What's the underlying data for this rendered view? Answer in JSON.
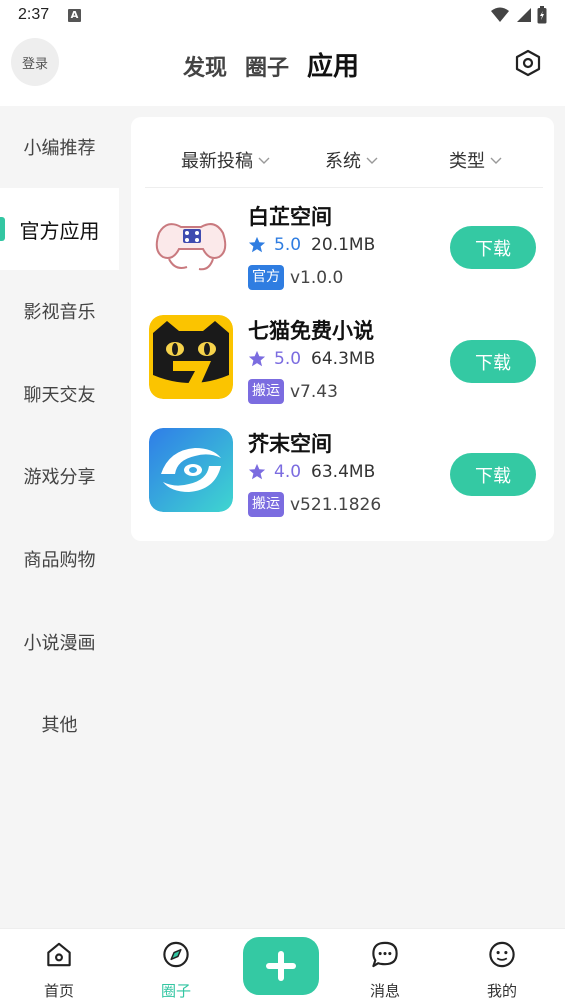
{
  "status_bar": {
    "time": "2:37",
    "notification_letter": "A"
  },
  "header": {
    "login_label": "登录",
    "tabs": [
      {
        "label": "发现",
        "active": false
      },
      {
        "label": "圈子",
        "active": false
      },
      {
        "label": "应用",
        "active": true
      }
    ]
  },
  "sidebar": {
    "items": [
      {
        "label": "小编推荐",
        "active": false
      },
      {
        "label": "官方应用",
        "active": true
      },
      {
        "label": "影视音乐",
        "active": false
      },
      {
        "label": "聊天交友",
        "active": false
      },
      {
        "label": "游戏分享",
        "active": false
      },
      {
        "label": "商品购物",
        "active": false
      },
      {
        "label": "小说漫画",
        "active": false
      },
      {
        "label": "其他",
        "active": false
      }
    ]
  },
  "filters": [
    {
      "label": "最新投稿"
    },
    {
      "label": "系统"
    },
    {
      "label": "类型"
    }
  ],
  "apps": [
    {
      "name": "白芷空间",
      "rating": "5.0",
      "size": "20.1MB",
      "tag": "官方",
      "tag_color": "#2f7de1",
      "rating_color": "#2f7de1",
      "version": "v1.0.0",
      "icon": "game-controller-icon",
      "download_label": "下载"
    },
    {
      "name": "七猫免费小说",
      "rating": "5.0",
      "size": "64.3MB",
      "tag": "搬运",
      "tag_color": "#7b6ce0",
      "rating_color": "#7b6ce0",
      "version": "v7.43",
      "icon": "cat-seven-icon",
      "download_label": "下载"
    },
    {
      "name": "芥末空间",
      "rating": "4.0",
      "size": "63.4MB",
      "tag": "搬运",
      "tag_color": "#7b6ce0",
      "rating_color": "#7b6ce0",
      "version": "v521.1826",
      "icon": "swirl-icon",
      "download_label": "下载"
    }
  ],
  "bottom_nav": {
    "items": [
      {
        "label": "首页",
        "icon": "home-icon",
        "active": false
      },
      {
        "label": "圈子",
        "icon": "compass-icon",
        "active": true
      },
      {
        "label": "消息",
        "icon": "chat-icon",
        "active": false
      },
      {
        "label": "我的",
        "icon": "profile-icon",
        "active": false
      }
    ],
    "add_icon": "plus-icon"
  },
  "colors": {
    "accent": "#34c9a3",
    "official_tag": "#2f7de1",
    "repost_tag": "#7b6ce0",
    "background": "#f5f5f5"
  }
}
